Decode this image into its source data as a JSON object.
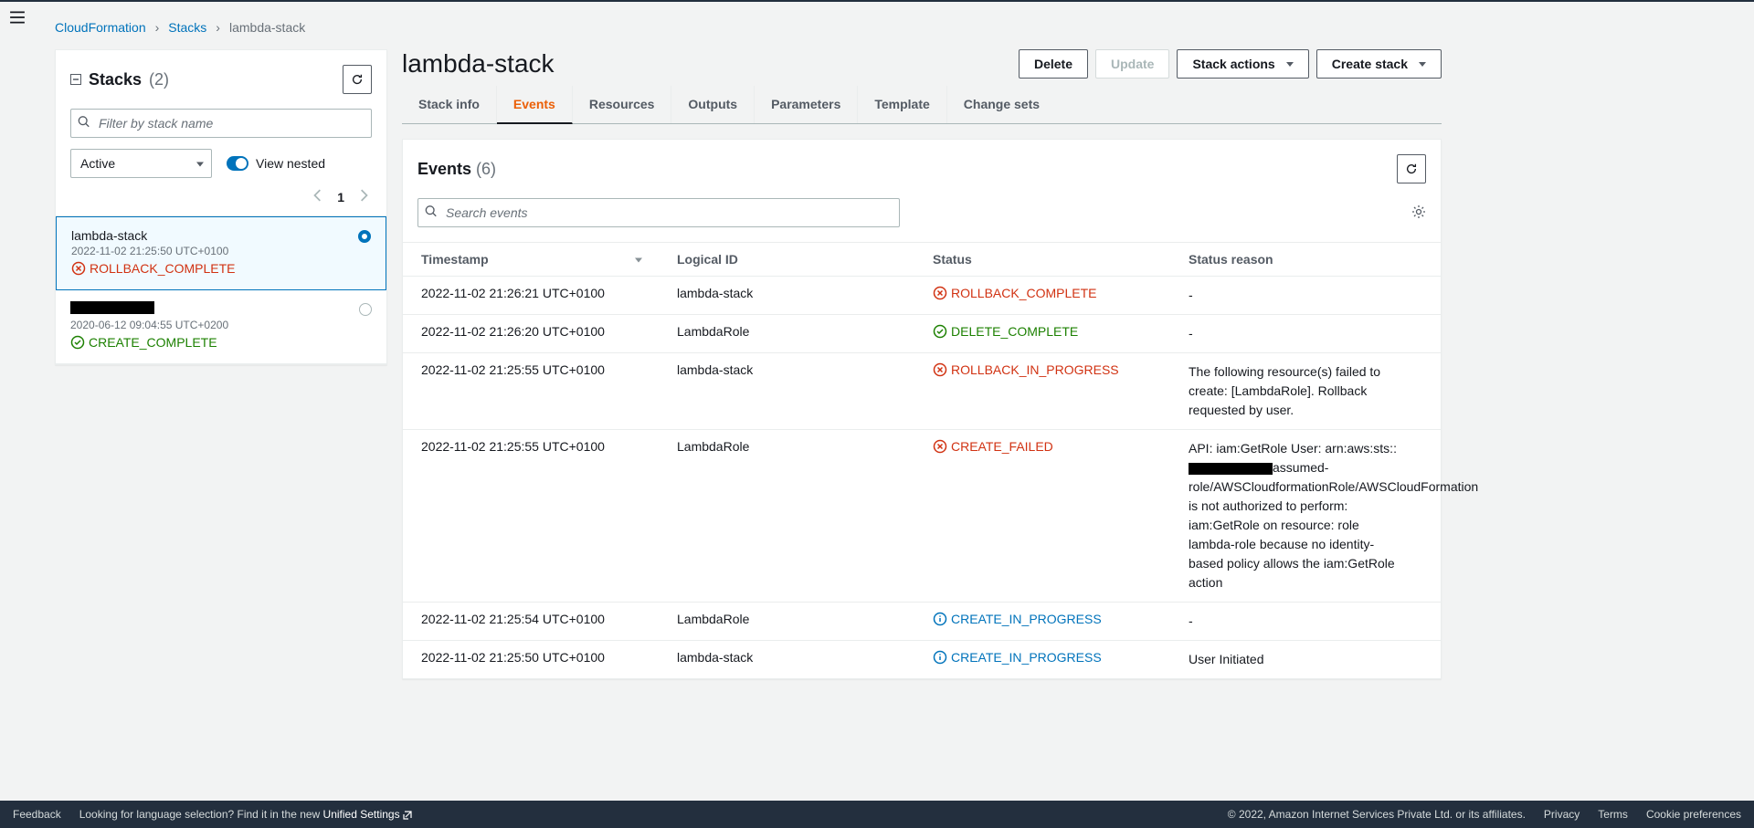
{
  "breadcrumb": {
    "root": "CloudFormation",
    "stacks": "Stacks",
    "current": "lambda-stack"
  },
  "sidebar": {
    "title": "Stacks",
    "count": "(2)",
    "filter_placeholder": "Filter by stack name",
    "status_filter": "Active",
    "view_nested": "View nested",
    "page": "1",
    "items": [
      {
        "name": "lambda-stack",
        "time": "2022-11-02 21:25:50 UTC+0100",
        "status": "ROLLBACK_COMPLETE",
        "status_class": "red",
        "selected": true,
        "redacted": false
      },
      {
        "name": "",
        "time": "2020-06-12 09:04:55 UTC+0200",
        "status": "CREATE_COMPLETE",
        "status_class": "green",
        "selected": false,
        "redacted": true
      }
    ]
  },
  "main": {
    "title": "lambda-stack",
    "actions": {
      "delete": "Delete",
      "update": "Update",
      "stack_actions": "Stack actions",
      "create_stack": "Create stack"
    }
  },
  "tabs": [
    {
      "label": "Stack info",
      "active": false
    },
    {
      "label": "Events",
      "active": true
    },
    {
      "label": "Resources",
      "active": false
    },
    {
      "label": "Outputs",
      "active": false
    },
    {
      "label": "Parameters",
      "active": false
    },
    {
      "label": "Template",
      "active": false
    },
    {
      "label": "Change sets",
      "active": false
    }
  ],
  "events": {
    "title": "Events",
    "count": "(6)",
    "search_placeholder": "Search events",
    "columns": {
      "timestamp": "Timestamp",
      "logical_id": "Logical ID",
      "status": "Status",
      "reason": "Status reason"
    },
    "rows": [
      {
        "timestamp": "2022-11-02 21:26:21 UTC+0100",
        "logical_id": "lambda-stack",
        "status": "ROLLBACK_COMPLETE",
        "status_class": "red",
        "icon": "x-circle",
        "reason": "-",
        "reason_type": "text"
      },
      {
        "timestamp": "2022-11-02 21:26:20 UTC+0100",
        "logical_id": "LambdaRole",
        "status": "DELETE_COMPLETE",
        "status_class": "green",
        "icon": "check-circle",
        "reason": "-",
        "reason_type": "text"
      },
      {
        "timestamp": "2022-11-02 21:25:55 UTC+0100",
        "logical_id": "lambda-stack",
        "status": "ROLLBACK_IN_PROGRESS",
        "status_class": "red",
        "icon": "x-circle",
        "reason": "The following resource(s) failed to create: [LambdaRole]. Rollback requested by user.",
        "reason_type": "text"
      },
      {
        "timestamp": "2022-11-02 21:25:55 UTC+0100",
        "logical_id": "LambdaRole",
        "status": "CREATE_FAILED",
        "status_class": "red",
        "icon": "x-circle",
        "reason_type": "redacted",
        "reason_pre": "API: iam:GetRole User: arn:aws:sts::",
        "reason_post": "assumed-role/AWSCloudformationRole/AWSCloudFormation is not authorized to perform: iam:GetRole on resource: role lambda-role because no identity-based policy allows the iam:GetRole action"
      },
      {
        "timestamp": "2022-11-02 21:25:54 UTC+0100",
        "logical_id": "LambdaRole",
        "status": "CREATE_IN_PROGRESS",
        "status_class": "blue",
        "icon": "info-circle",
        "reason": "-",
        "reason_type": "text"
      },
      {
        "timestamp": "2022-11-02 21:25:50 UTC+0100",
        "logical_id": "lambda-stack",
        "status": "CREATE_IN_PROGRESS",
        "status_class": "blue",
        "icon": "info-circle",
        "reason": "User Initiated",
        "reason_type": "text"
      }
    ]
  },
  "footer": {
    "feedback": "Feedback",
    "lang_text": "Looking for language selection? Find it in the new ",
    "unified": "Unified Settings",
    "copyright": "© 2022, Amazon Internet Services Private Ltd. or its affiliates.",
    "privacy": "Privacy",
    "terms": "Terms",
    "cookies": "Cookie preferences"
  }
}
